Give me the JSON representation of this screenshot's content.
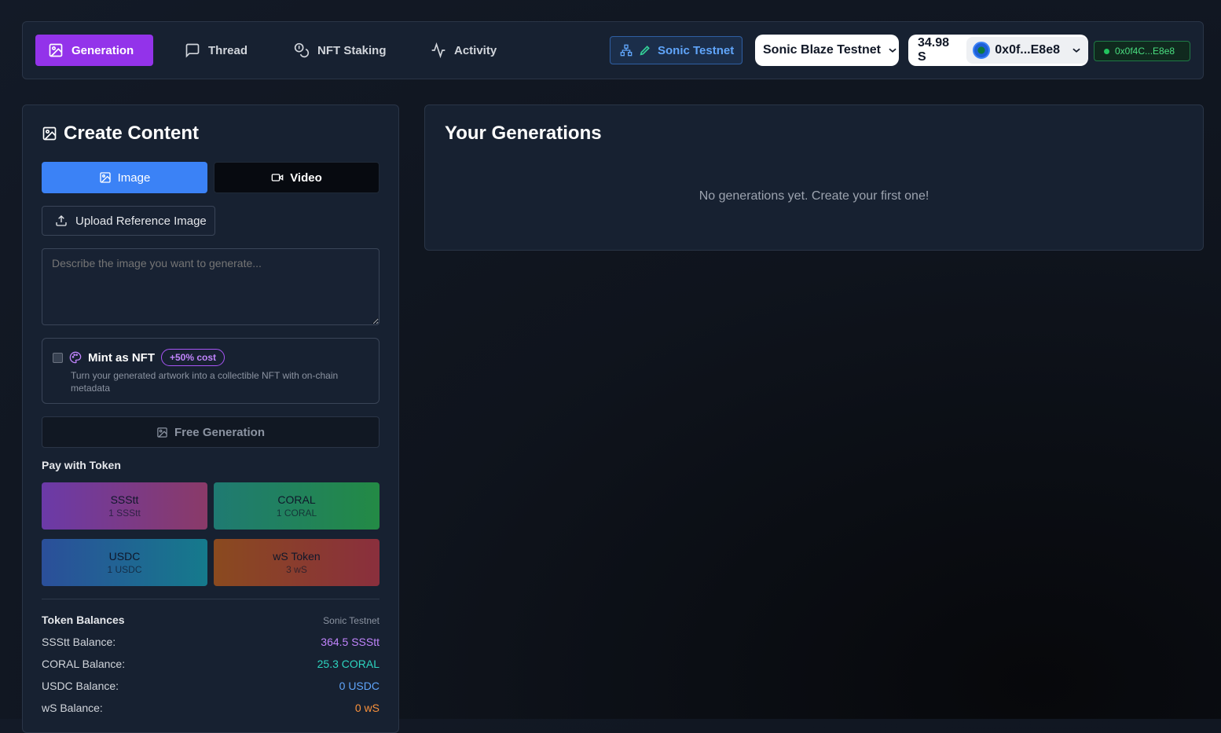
{
  "nav": {
    "items": [
      {
        "label": "Generation",
        "icon": "image-icon",
        "active": true
      },
      {
        "label": "Thread",
        "icon": "message-icon"
      },
      {
        "label": "NFT Staking",
        "icon": "coins-icon"
      },
      {
        "label": "Activity",
        "icon": "activity-icon"
      }
    ],
    "network_label": "Sonic Testnet",
    "chain_select": "Sonic Blaze Testnet",
    "balance": "34.98 S",
    "account": "0x0f...E8e8",
    "connected_address": "0x0f4C...E8e8"
  },
  "create": {
    "title": "Create Content",
    "tab_image": "Image",
    "tab_video": "Video",
    "upload_label": "Upload Reference Image",
    "prompt_placeholder": "Describe the image you want to generate...",
    "nft_label": "Mint as NFT",
    "nft_badge": "+50% cost",
    "nft_desc": "Turn your generated artwork into a collectible NFT with on-chain metadata",
    "free_label": "Free Generation",
    "pay_label": "Pay with Token",
    "tokens": [
      {
        "name": "SSStt",
        "cost": "1 SSStt"
      },
      {
        "name": "CORAL",
        "cost": "1 CORAL"
      },
      {
        "name": "USDC",
        "cost": "1 USDC"
      },
      {
        "name": "wS Token",
        "cost": "3 wS"
      }
    ],
    "balances_title": "Token Balances",
    "balances_network": "Sonic Testnet",
    "balances": [
      {
        "label": "SSStt Balance:",
        "value": "364.5 SSStt",
        "color": "#c084fc"
      },
      {
        "label": "CORAL Balance:",
        "value": "25.3 CORAL",
        "color": "#2dd4bf"
      },
      {
        "label": "USDC Balance:",
        "value": "0 USDC",
        "color": "#60a5fa"
      },
      {
        "label": "wS Balance:",
        "value": "0 wS",
        "color": "#fb923c"
      }
    ]
  },
  "generations": {
    "title": "Your Generations",
    "empty": "No generations yet. Create your first one!"
  }
}
